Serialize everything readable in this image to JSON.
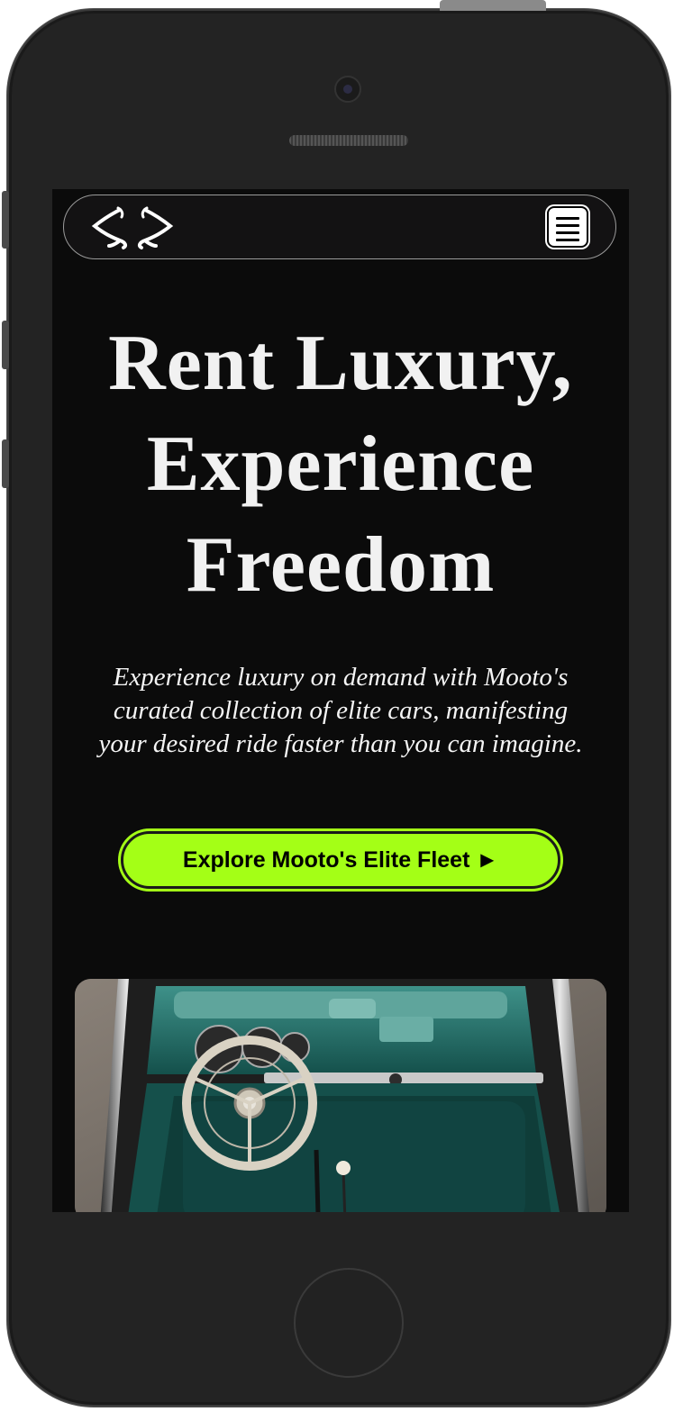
{
  "navbar": {
    "logo_icon": "angle-brackets-logo",
    "menu_icon": "hamburger-menu-icon"
  },
  "hero": {
    "title_line1": "Rent Luxury,",
    "title_line2": "Experience",
    "title_line3": "Freedom",
    "subtitle": "Experience luxury on demand with Mooto's curated collection of elite cars, manifesting your desired ride faster than you can imagine.",
    "cta_label": "Explore Mooto's Elite Fleet ►",
    "image_subject": "vintage-car-interior-teal"
  },
  "colors": {
    "background": "#0b0b0b",
    "accent": "#a4ff16",
    "text": "#f1f1f1",
    "interior": "#1d6b64"
  }
}
